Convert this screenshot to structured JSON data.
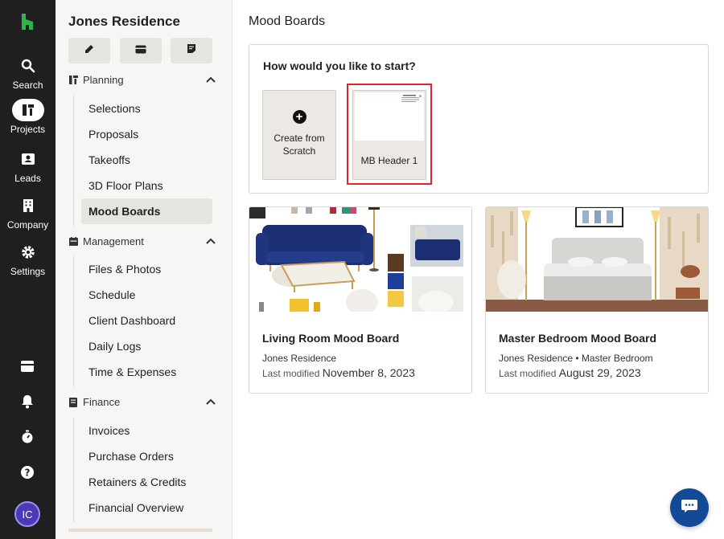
{
  "rail": {
    "items": [
      {
        "label": "Search",
        "icon": "search-icon"
      },
      {
        "label": "Projects",
        "icon": "projects-icon",
        "active": true
      },
      {
        "label": "Leads",
        "icon": "leads-icon"
      },
      {
        "label": "Company",
        "icon": "company-icon"
      },
      {
        "label": "Settings",
        "icon": "gear-icon"
      }
    ],
    "bottom_icons": [
      "inbox-icon",
      "bell-icon",
      "timer-icon",
      "help-icon"
    ],
    "avatar_initials": "IC"
  },
  "sidebar": {
    "project_title": "Jones Residence",
    "quick_actions": [
      "edit-icon",
      "message-icon",
      "note-icon"
    ],
    "sections": [
      {
        "label": "Planning",
        "icon": "planning-icon",
        "items": [
          "Selections",
          "Proposals",
          "Takeoffs",
          "3D Floor Plans",
          "Mood Boards"
        ]
      },
      {
        "label": "Management",
        "icon": "management-icon",
        "items": [
          "Files & Photos",
          "Schedule",
          "Client Dashboard",
          "Daily Logs",
          "Time & Expenses"
        ]
      },
      {
        "label": "Finance",
        "icon": "finance-icon",
        "items": [
          "Invoices",
          "Purchase Orders",
          "Retainers & Credits",
          "Financial Overview"
        ]
      }
    ],
    "active_item": "Mood Boards"
  },
  "main": {
    "title": "Mood Boards",
    "start": {
      "question": "How would you like to start?",
      "scratch_label_1": "Create from",
      "scratch_label_2": "Scratch",
      "template_label": "MB Header 1"
    },
    "boards": [
      {
        "name": "Living Room Mood Board",
        "subtitle": "Jones Residence",
        "modified_prefix": "Last modified",
        "modified_date": "November 8, 2023"
      },
      {
        "name": "Master Bedroom Mood Board",
        "subtitle": "Jones Residence • Master Bedroom",
        "modified_prefix": "Last modified",
        "modified_date": "August 29, 2023"
      }
    ]
  },
  "colors": {
    "rail_bg": "#1f1f1f",
    "accent_green": "#2fb34a",
    "highlight_red": "#e0252b",
    "chat_blue": "#134a95",
    "avatar_purple": "#4a3ab8"
  }
}
